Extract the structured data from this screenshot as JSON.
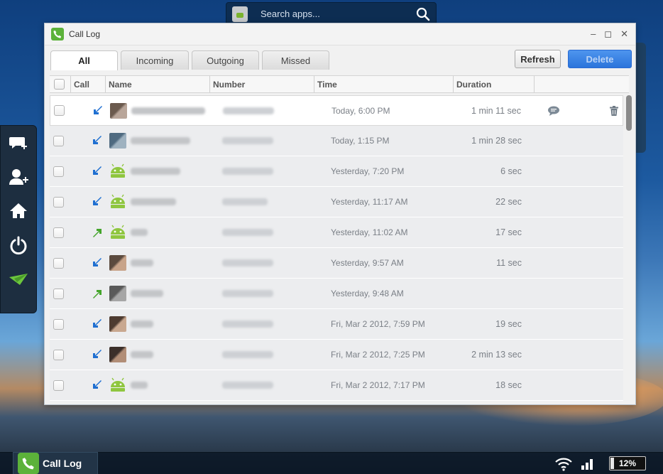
{
  "search": {
    "placeholder": "Search apps..."
  },
  "window": {
    "title": "Call Log"
  },
  "tabs": [
    {
      "label": "All"
    },
    {
      "label": "Incoming"
    },
    {
      "label": "Outgoing"
    },
    {
      "label": "Missed"
    }
  ],
  "toolbar": {
    "refresh_label": "Refresh",
    "delete_label": "Delete"
  },
  "table": {
    "columns": [
      "Call",
      "Name",
      "Number",
      "Time",
      "Duration"
    ],
    "rows": [
      {
        "type": "incoming",
        "avatar": "photo",
        "time": "Today, 6:00 PM",
        "duration": "1 min 11 sec"
      },
      {
        "type": "incoming",
        "avatar": "photo",
        "time": "Today, 1:15 PM",
        "duration": "1 min 28 sec"
      },
      {
        "type": "incoming",
        "avatar": "android",
        "time": "Yesterday, 7:20 PM",
        "duration": "6 sec"
      },
      {
        "type": "incoming",
        "avatar": "android",
        "time": "Yesterday, 11:17 AM",
        "duration": "22 sec"
      },
      {
        "type": "outgoing",
        "avatar": "android",
        "time": "Yesterday, 11:02 AM",
        "duration": "17 sec"
      },
      {
        "type": "incoming",
        "avatar": "photo",
        "time": "Yesterday, 9:57 AM",
        "duration": "11 sec"
      },
      {
        "type": "outgoing",
        "avatar": "photo",
        "time": "Yesterday, 9:48 AM",
        "duration": ""
      },
      {
        "type": "incoming",
        "avatar": "photo",
        "time": "Fri, Mar 2 2012, 7:59 PM",
        "duration": "19 sec"
      },
      {
        "type": "incoming",
        "avatar": "photo",
        "time": "Fri, Mar 2 2012, 7:25 PM",
        "duration": "2 min 13 sec"
      },
      {
        "type": "incoming",
        "avatar": "android",
        "time": "Fri, Mar 2 2012, 7:17 PM",
        "duration": "18 sec"
      }
    ]
  },
  "taskbar": {
    "app_label": "Call Log",
    "battery": "12%"
  },
  "colors": {
    "incoming": "#1f6fd1",
    "outgoing": "#45a52c",
    "accent": "#2b74db"
  }
}
